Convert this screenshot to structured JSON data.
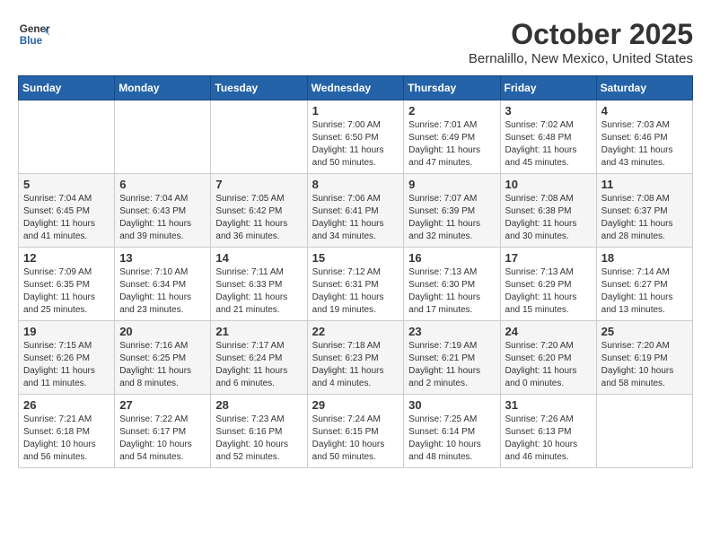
{
  "header": {
    "logo_line1": "General",
    "logo_line2": "Blue",
    "month": "October 2025",
    "location": "Bernalillo, New Mexico, United States"
  },
  "days_of_week": [
    "Sunday",
    "Monday",
    "Tuesday",
    "Wednesday",
    "Thursday",
    "Friday",
    "Saturday"
  ],
  "weeks": [
    [
      {
        "num": "",
        "info": ""
      },
      {
        "num": "",
        "info": ""
      },
      {
        "num": "",
        "info": ""
      },
      {
        "num": "1",
        "info": "Sunrise: 7:00 AM\nSunset: 6:50 PM\nDaylight: 11 hours\nand 50 minutes."
      },
      {
        "num": "2",
        "info": "Sunrise: 7:01 AM\nSunset: 6:49 PM\nDaylight: 11 hours\nand 47 minutes."
      },
      {
        "num": "3",
        "info": "Sunrise: 7:02 AM\nSunset: 6:48 PM\nDaylight: 11 hours\nand 45 minutes."
      },
      {
        "num": "4",
        "info": "Sunrise: 7:03 AM\nSunset: 6:46 PM\nDaylight: 11 hours\nand 43 minutes."
      }
    ],
    [
      {
        "num": "5",
        "info": "Sunrise: 7:04 AM\nSunset: 6:45 PM\nDaylight: 11 hours\nand 41 minutes."
      },
      {
        "num": "6",
        "info": "Sunrise: 7:04 AM\nSunset: 6:43 PM\nDaylight: 11 hours\nand 39 minutes."
      },
      {
        "num": "7",
        "info": "Sunrise: 7:05 AM\nSunset: 6:42 PM\nDaylight: 11 hours\nand 36 minutes."
      },
      {
        "num": "8",
        "info": "Sunrise: 7:06 AM\nSunset: 6:41 PM\nDaylight: 11 hours\nand 34 minutes."
      },
      {
        "num": "9",
        "info": "Sunrise: 7:07 AM\nSunset: 6:39 PM\nDaylight: 11 hours\nand 32 minutes."
      },
      {
        "num": "10",
        "info": "Sunrise: 7:08 AM\nSunset: 6:38 PM\nDaylight: 11 hours\nand 30 minutes."
      },
      {
        "num": "11",
        "info": "Sunrise: 7:08 AM\nSunset: 6:37 PM\nDaylight: 11 hours\nand 28 minutes."
      }
    ],
    [
      {
        "num": "12",
        "info": "Sunrise: 7:09 AM\nSunset: 6:35 PM\nDaylight: 11 hours\nand 25 minutes."
      },
      {
        "num": "13",
        "info": "Sunrise: 7:10 AM\nSunset: 6:34 PM\nDaylight: 11 hours\nand 23 minutes."
      },
      {
        "num": "14",
        "info": "Sunrise: 7:11 AM\nSunset: 6:33 PM\nDaylight: 11 hours\nand 21 minutes."
      },
      {
        "num": "15",
        "info": "Sunrise: 7:12 AM\nSunset: 6:31 PM\nDaylight: 11 hours\nand 19 minutes."
      },
      {
        "num": "16",
        "info": "Sunrise: 7:13 AM\nSunset: 6:30 PM\nDaylight: 11 hours\nand 17 minutes."
      },
      {
        "num": "17",
        "info": "Sunrise: 7:13 AM\nSunset: 6:29 PM\nDaylight: 11 hours\nand 15 minutes."
      },
      {
        "num": "18",
        "info": "Sunrise: 7:14 AM\nSunset: 6:27 PM\nDaylight: 11 hours\nand 13 minutes."
      }
    ],
    [
      {
        "num": "19",
        "info": "Sunrise: 7:15 AM\nSunset: 6:26 PM\nDaylight: 11 hours\nand 11 minutes."
      },
      {
        "num": "20",
        "info": "Sunrise: 7:16 AM\nSunset: 6:25 PM\nDaylight: 11 hours\nand 8 minutes."
      },
      {
        "num": "21",
        "info": "Sunrise: 7:17 AM\nSunset: 6:24 PM\nDaylight: 11 hours\nand 6 minutes."
      },
      {
        "num": "22",
        "info": "Sunrise: 7:18 AM\nSunset: 6:23 PM\nDaylight: 11 hours\nand 4 minutes."
      },
      {
        "num": "23",
        "info": "Sunrise: 7:19 AM\nSunset: 6:21 PM\nDaylight: 11 hours\nand 2 minutes."
      },
      {
        "num": "24",
        "info": "Sunrise: 7:20 AM\nSunset: 6:20 PM\nDaylight: 11 hours\nand 0 minutes."
      },
      {
        "num": "25",
        "info": "Sunrise: 7:20 AM\nSunset: 6:19 PM\nDaylight: 10 hours\nand 58 minutes."
      }
    ],
    [
      {
        "num": "26",
        "info": "Sunrise: 7:21 AM\nSunset: 6:18 PM\nDaylight: 10 hours\nand 56 minutes."
      },
      {
        "num": "27",
        "info": "Sunrise: 7:22 AM\nSunset: 6:17 PM\nDaylight: 10 hours\nand 54 minutes."
      },
      {
        "num": "28",
        "info": "Sunrise: 7:23 AM\nSunset: 6:16 PM\nDaylight: 10 hours\nand 52 minutes."
      },
      {
        "num": "29",
        "info": "Sunrise: 7:24 AM\nSunset: 6:15 PM\nDaylight: 10 hours\nand 50 minutes."
      },
      {
        "num": "30",
        "info": "Sunrise: 7:25 AM\nSunset: 6:14 PM\nDaylight: 10 hours\nand 48 minutes."
      },
      {
        "num": "31",
        "info": "Sunrise: 7:26 AM\nSunset: 6:13 PM\nDaylight: 10 hours\nand 46 minutes."
      },
      {
        "num": "",
        "info": ""
      }
    ]
  ]
}
